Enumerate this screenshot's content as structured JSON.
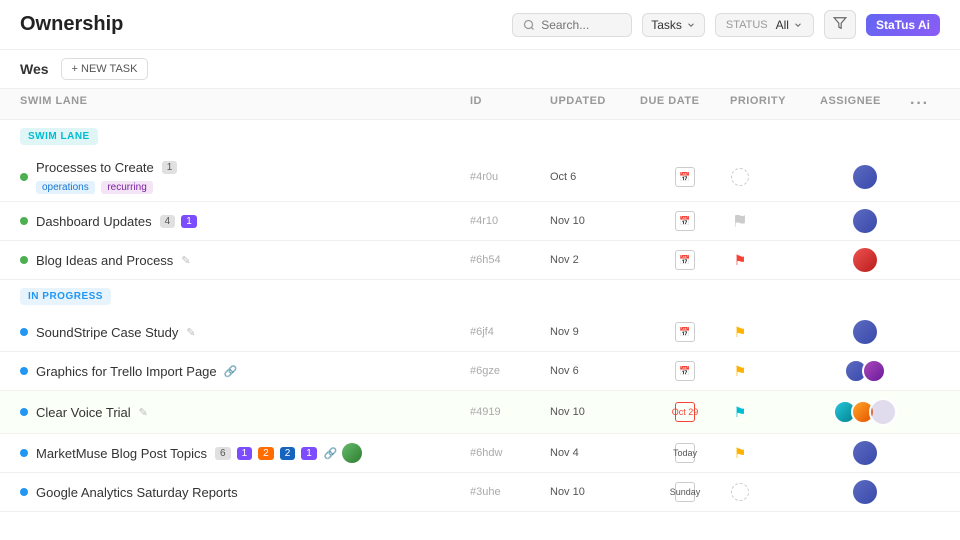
{
  "page": {
    "title": "Ownership"
  },
  "header": {
    "search": {
      "placeholder": "Search..."
    },
    "tasks_label": "Tasks",
    "status_label": "STATUS",
    "status_value": "All",
    "logo": "StaTus Ai"
  },
  "subheader": {
    "user": "Wes",
    "new_task_btn": "+ NEW TASK"
  },
  "table": {
    "columns": [
      "SWIM LANE",
      "ID",
      "UPDATED",
      "DUE DATE",
      "PRIORITY",
      "ASSIGNEE",
      ""
    ]
  },
  "sections": [
    {
      "label": "SWIM LANE",
      "tasks": [
        {
          "name": "Processes to Create",
          "count": "1",
          "tag1": "operations",
          "tag2": "recurring",
          "id": "#4r0u",
          "updated": "Oct 6",
          "due_date": ""
        },
        {
          "name": "Dashboard Updates",
          "count": "4",
          "notif": "1",
          "id": "#4r10",
          "updated": "Nov 10",
          "due_date": ""
        },
        {
          "name": "Blog Ideas and Process",
          "id": "#6h54",
          "updated": "Nov 2",
          "due_date": ""
        }
      ]
    },
    {
      "label": "IN PROGRESS",
      "tasks": [
        {
          "name": "SoundStripe Case Study",
          "id": "#6jf4",
          "updated": "Nov 9",
          "due_date": ""
        },
        {
          "name": "Graphics for Trello Import Page",
          "id": "#6gze",
          "updated": "Nov 6",
          "due_date": ""
        },
        {
          "name": "Clear Voice Trial",
          "id": "#4919",
          "updated": "Nov 10",
          "due_date": "Oct 29"
        },
        {
          "name": "MarketMuse Blog Post Topics",
          "badge1": "6",
          "badge2": "1",
          "badge3": "2",
          "badge4": "2",
          "badge5": "1",
          "id": "#6hdw",
          "updated": "Nov 4",
          "due_date": "Today"
        },
        {
          "name": "Google Analytics Saturday Reports",
          "id": "#3uhe",
          "updated": "Nov 10",
          "due_date": "Sunday"
        }
      ]
    }
  ]
}
